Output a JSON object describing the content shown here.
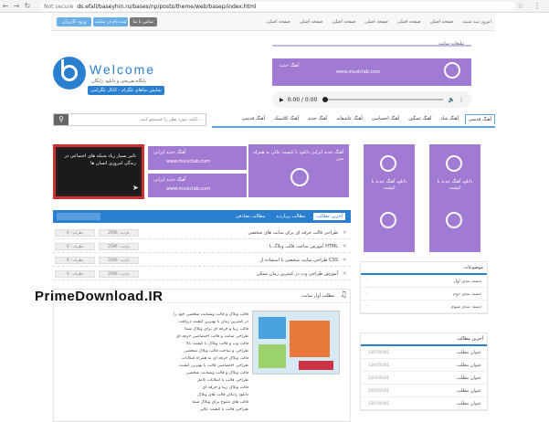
{
  "browser": {
    "security": "Not secure",
    "url": "ds.efall/baseyhin.ru/bases/np/posts/theme/web/basep/index.html"
  },
  "topbar": {
    "buttons": [
      {
        "label": "ورود کاربران",
        "color": "#6aaee8"
      },
      {
        "label": "ثبت نام در سایت",
        "color": "#6aaee8"
      },
      {
        "label": "تماس با ما",
        "color": "#777777"
      }
    ],
    "menu": [
      "صفحه اصلی",
      "صفحه اصلی",
      "صفحه اصلی",
      "صفحه اصلی",
      "صفحه اصلی",
      "صفحه اصلی",
      "امروز سه شنبه"
    ]
  },
  "header": {
    "logo_text": "Welcome",
    "tagline": "پایگاه تفریحی و دانلود رایگان",
    "tagline_button": "نمایش نماهای تلگرام - کانال تلگرامی",
    "ad_label": "تبلیغات سایت",
    "ad_top_text1": "آهنگ جدید",
    "ad_top_text2": "www.musiclab.com"
  },
  "audio": {
    "time": "0:00 / 0:00"
  },
  "search": {
    "placeholder": "کلمه مورد نظر را جستجو کنید..."
  },
  "categories": [
    "آهنگ قدیمی",
    "آهنگ شاد",
    "آهنگ غمگین",
    "آهنگ احساسی",
    "آهنگ عاشقانه",
    "آهنگ جدید",
    "آهنگ کلاسیک",
    "آهنگ قدیمی"
  ],
  "news_card": {
    "text": "تاثیر بسیار زیاد شبکه های اجتماعی در زندگی امروزی انسان ها",
    "send_icon": "send-icon"
  },
  "mid_ads": [
    {
      "t1": "آهنگ جدید ایرانی",
      "t2": "www.musiclab.com"
    },
    {
      "t1": "آهنگ جدید ایرانی",
      "t2": "www.musiclab.com"
    }
  ],
  "mid_big_ad": {
    "text": "آهنگ جدید ایرانی\nدانلود با کیفیت عالی\nبه همراه متن"
  },
  "side_ads": [
    {
      "text": "دانلود آهنگ جدید با کیفیت"
    },
    {
      "text": "دانلود آهنگ جدید با کیفیت"
    }
  ],
  "posts_list": {
    "tabs": [
      "آخرین مطالب",
      "مطالب پربازدید",
      "مطالب تصادفی"
    ],
    "rows": [
      {
        "title": "طراحی قالب حرفه ای برای سایت های شخصی",
        "m1": "بازدید : 2596",
        "m2": "نظرات : 0"
      },
      {
        "title": "آموزش ساخت قالب وبلاگ با HTML",
        "m1": "بازدید : 2596",
        "m2": "نظرات : 0"
      },
      {
        "title": "طراحی سایت شخصی با استفاده از CSS",
        "m1": "بازدید : 2596",
        "m2": "نظرات : 0"
      },
      {
        "title": "آموزش طراحی وب در کمترین زمان ممکن",
        "m1": "بازدید : 2596",
        "m2": "نظرات : 0"
      }
    ]
  },
  "sidebar": {
    "box1": {
      "title": "موضوعات",
      "rows": [
        "دسته بندی اول",
        "دسته بندی دوم",
        "دسته بندی سوم"
      ]
    },
    "box2": {
      "title": "آخرین مطالب",
      "rows": [
        {
          "title": "عنوان مطلب",
          "meta": "1397/01/01"
        },
        {
          "title": "عنوان مطلب",
          "meta": "1397/01/01"
        },
        {
          "title": "عنوان مطلب",
          "meta": "1397/01/01"
        },
        {
          "title": "عنوان مطلب",
          "meta": "1397/01/01"
        },
        {
          "title": "عنوان مطلب",
          "meta": "1397/01/01"
        }
      ]
    }
  },
  "article": {
    "title": "مطلب اول سایت",
    "lines": [
      "قالب وبلاگ و قالب وبسایت شخصی خود را",
      "در کمترین زمان با بهترین کیفیت دریافت",
      "قالب زیبا و حرفه ای برای وبلاگ شما",
      "طراحی سایت و قالب اختصاصی حرفه ای",
      "قالب وب و قالب وبلاگ با کیفیت بالا",
      "طراحی و ساخت قالب وبلاگ شخصی",
      "قالب وبلاگ حرفه ای به همراه امکانات",
      "طراحی اختصاصی قالب با بهترین کیفیت",
      "قالب وبلاگ و قالب وبسایت شخصی",
      "طراحی قالب با امکانات کامل",
      "قالب وبلاگ زیبا و حرفه ای",
      "دانلود رایگان قالب های وبلاگ",
      "قالب های متنوع برای وبلاگ شما",
      "طراحی قالب با کیفیت عالی"
    ]
  },
  "watermark": "PrimeDownload.IR"
}
